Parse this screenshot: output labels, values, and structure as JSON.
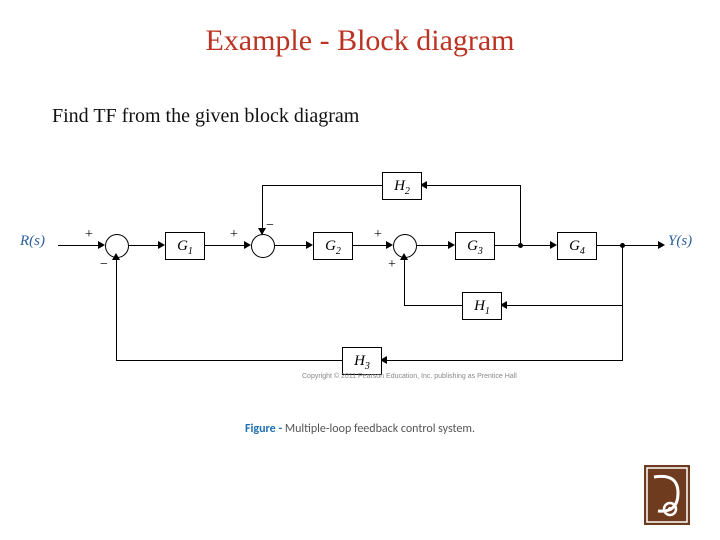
{
  "title": "Example  - Block diagram",
  "prompt": "Find TF from the given block diagram",
  "caption_label": "Figure -",
  "caption_text": "   Multiple-loop feedback control system.",
  "copyright": "Copyright © 2011 Pearson Education, Inc. publishing as Prentice Hall",
  "input_label": "R(s)",
  "output_label": "Y(s)",
  "blocks": {
    "g1": "G",
    "g1s": "1",
    "g2": "G",
    "g2s": "2",
    "g3": "G",
    "g3s": "3",
    "g4": "G",
    "g4s": "4",
    "h1": "H",
    "h1s": "1",
    "h2": "H",
    "h2s": "2",
    "h3": "H",
    "h3s": "3"
  },
  "signs": {
    "s1_top": "+",
    "s1_bot": "−",
    "s2_top": "+",
    "s2_bot": "−",
    "s3_top": "+",
    "s3_bot": "+"
  }
}
